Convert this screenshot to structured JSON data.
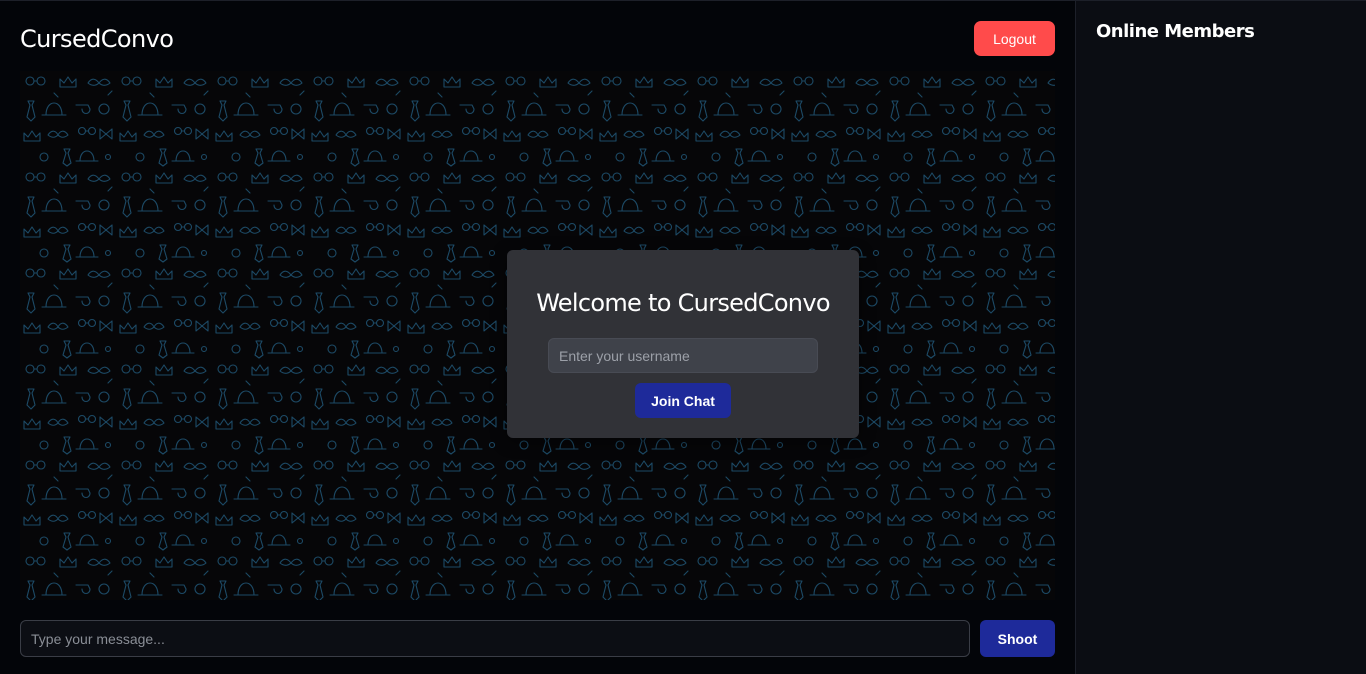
{
  "app": {
    "title": "CursedConvo",
    "logout_label": "Logout"
  },
  "welcome": {
    "title": "Welcome to CursedConvo",
    "username_placeholder": "Enter your username",
    "username_value": "",
    "join_label": "Join Chat"
  },
  "composer": {
    "message_placeholder": "Type your message...",
    "message_value": "",
    "send_label": "Shoot"
  },
  "sidebar": {
    "title": "Online Members",
    "members": []
  },
  "colors": {
    "page_background": "#030509",
    "sidebar_background": "#0b0d13",
    "logout_button": "#ff4b4b",
    "primary_button": "#1e2a9a",
    "card_background": "#313237",
    "doodle_stroke": "#1c4a66"
  },
  "icons": {
    "chat_background": "doodle-pattern-background"
  }
}
